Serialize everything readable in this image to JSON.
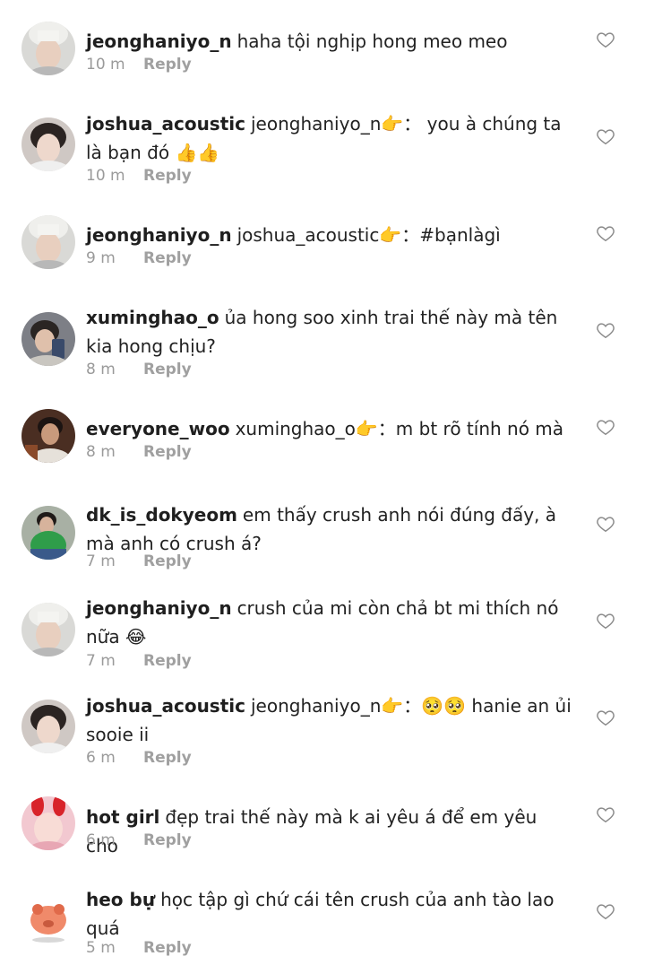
{
  "comments": [
    {
      "user": "jeonghaniyo_n",
      "text": "haha tội nghịp hong meo meo",
      "time": "10 m",
      "reply": "Reply",
      "avatar": "avatar-a"
    },
    {
      "user": "joshua_acoustic",
      "text": "jeonghaniyo_n👉： you à chúng ta là bạn đó 👍👍",
      "time": "10 m",
      "reply": "Reply",
      "avatar": "avatar-b"
    },
    {
      "user": "jeonghaniyo_n",
      "text": "joshua_acoustic👉：#bạnlàgì",
      "time": "9 m",
      "reply": "Reply",
      "avatar": "avatar-a"
    },
    {
      "user": "xuminghao_o",
      "text": "ủa hong soo xinh trai thế này mà tên kia hong chịu?",
      "time": "8 m",
      "reply": "Reply",
      "avatar": "avatar-c"
    },
    {
      "user": "everyone_woo",
      "text": "xuminghao_o👉：m bt rõ tính nó mà",
      "time": "8 m",
      "reply": "Reply",
      "avatar": "avatar-d"
    },
    {
      "user": "dk_is_dokyeom",
      "text": "em thấy crush anh nói đúng đấy,  à mà anh có crush á?",
      "time": "7 m",
      "reply": "Reply",
      "avatar": "avatar-e"
    },
    {
      "user": "jeonghaniyo_n",
      "text": "crush của mi còn chả bt mi thích nó nữa 😂",
      "time": "7 m",
      "reply": "Reply",
      "avatar": "avatar-a"
    },
    {
      "user": "joshua_acoustic",
      "text": "jeonghaniyo_n👉：🥺🥺 hanie an ủi sooie ii",
      "time": "6 m",
      "reply": "Reply",
      "avatar": "avatar-b"
    },
    {
      "user": "hot girl",
      "text": "đẹp trai thế này mà k ai yêu á để em yêu cho",
      "time": "6 m",
      "reply": "Reply",
      "avatar": "avatar-f"
    },
    {
      "user": "heo bự",
      "text": "học tập gì chứ cái tên crush của anh tào lao quá",
      "time": "5 m",
      "reply": "Reply",
      "avatar": "avatar-g"
    }
  ]
}
